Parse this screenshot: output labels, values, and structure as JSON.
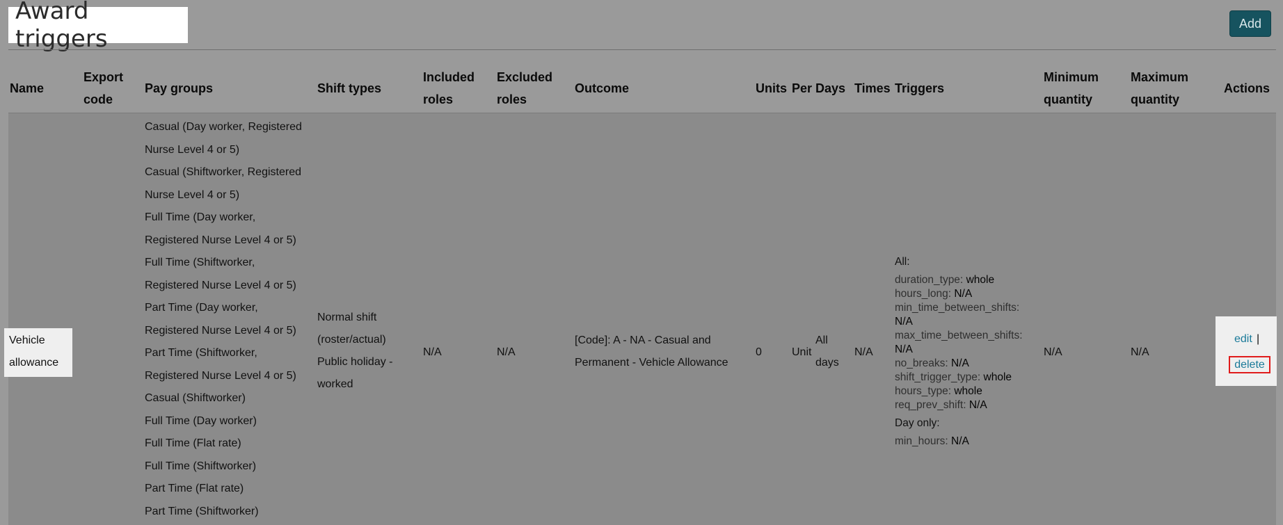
{
  "page": {
    "title": "Award triggers",
    "add_label": "Add"
  },
  "columns": {
    "name": "Name",
    "export_code": "Export code",
    "pay_groups": "Pay groups",
    "shift_types": "Shift types",
    "included_roles": "Included roles",
    "excluded_roles": "Excluded roles",
    "outcome": "Outcome",
    "units": "Units",
    "per": "Per",
    "days": "Days",
    "times": "Times",
    "triggers": "Triggers",
    "minimum_quantity": "Minimum quantity",
    "maximum_quantity": "Maximum quantity",
    "actions": "Actions"
  },
  "row": {
    "name": "Vehicle allowance",
    "export_code": "",
    "pay_groups": [
      "Casual (Day worker, Registered Nurse Level 4 or 5)",
      "Casual (Shiftworker, Registered Nurse Level 4 or 5)",
      "Full Time (Day worker, Registered Nurse Level 4 or 5)",
      "Full Time (Shiftworker, Registered Nurse Level 4 or 5)",
      "Part Time (Day worker, Registered Nurse Level 4 or 5)",
      "Part Time (Shiftworker, Registered Nurse Level 4 or 5)",
      "Casual (Shiftworker)",
      "Full Time (Day worker)",
      "Full Time (Flat rate)",
      "Full Time (Shiftworker)",
      "Part Time (Flat rate)",
      "Part Time (Shiftworker)"
    ],
    "shift_types": [
      "Normal shift (roster/actual)",
      "Public holiday - worked"
    ],
    "included_roles": "N/A",
    "excluded_roles": "N/A",
    "outcome": "[Code]: A - NA - Casual and Permanent - Vehicle Allowance",
    "units": "0",
    "per": "Unit",
    "days": "All days",
    "times": "N/A",
    "triggers": {
      "all_label": "All:",
      "all": [
        {
          "key": "duration_type:",
          "value": "whole"
        },
        {
          "key": "hours_long:",
          "value": "N/A"
        },
        {
          "key": "min_time_between_shifts:",
          "value": "N/A"
        },
        {
          "key": "max_time_between_shifts:",
          "value": "N/A"
        },
        {
          "key": "no_breaks:",
          "value": "N/A"
        },
        {
          "key": "shift_trigger_type:",
          "value": "whole"
        },
        {
          "key": "hours_type:",
          "value": "whole"
        },
        {
          "key": "req_prev_shift:",
          "value": "N/A"
        }
      ],
      "day_only_label": "Day only:",
      "day_only": [
        {
          "key": "min_hours:",
          "value": "N/A"
        }
      ]
    },
    "minimum_quantity": "N/A",
    "maximum_quantity": "N/A",
    "actions": {
      "edit": "edit",
      "separator": "|",
      "delete": "delete"
    }
  }
}
